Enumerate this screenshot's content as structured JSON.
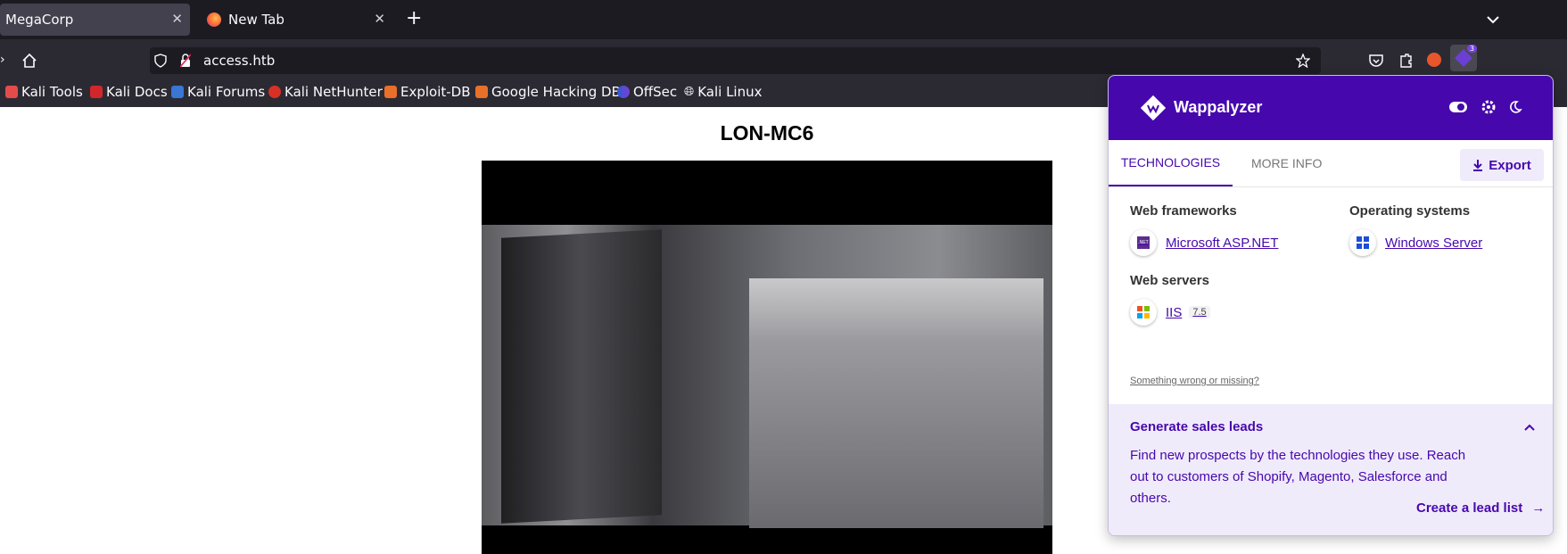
{
  "tabs": [
    {
      "title": "MegaCorp",
      "active": true
    },
    {
      "title": "New Tab",
      "active": false
    }
  ],
  "url": "access.htb",
  "bookmarks": [
    "Kali Tools",
    "Kali Docs",
    "Kali Forums",
    "Kali NetHunter",
    "Exploit-DB",
    "Google Hacking DB",
    "OffSec",
    "Kali Linux"
  ],
  "extension_badge": "3",
  "page": {
    "title": "LON-MC6"
  },
  "wappalyzer": {
    "brand": "Wappalyzer",
    "tabs": {
      "technologies": "TECHNOLOGIES",
      "more_info": "MORE INFO"
    },
    "export_label": "Export",
    "categories": [
      {
        "name": "Web frameworks",
        "items": [
          {
            "name": "Microsoft ASP.NET",
            "icon": "dotnet-icon"
          }
        ]
      },
      {
        "name": "Operating systems",
        "items": [
          {
            "name": "Windows Server",
            "icon": "windows-icon"
          }
        ]
      },
      {
        "name": "Web servers",
        "items": [
          {
            "name": "IIS",
            "version": "7.5",
            "icon": "microsoft-icon"
          }
        ]
      }
    ],
    "feedback_link": "Something wrong or missing?",
    "leads": {
      "title": "Generate sales leads",
      "description": "Find new prospects by the technologies they use. Reach out to customers of Shopify, Magento, Salesforce and others.",
      "link": "Create a lead list"
    }
  },
  "colors": {
    "accent": "#4608ad",
    "chrome_dark": "#1c1b22",
    "toolbar": "#2b2a33"
  }
}
